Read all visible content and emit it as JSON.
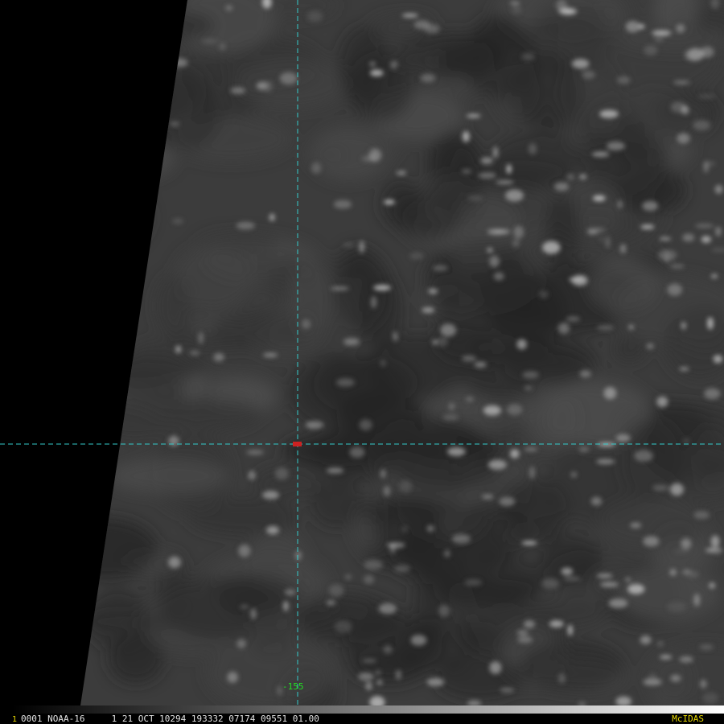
{
  "image": {
    "satellite": "NOAA-16",
    "frame_number": "1",
    "frame_info": "0001 NOAA-16     1 21 OCT 10294 193332 07174 09551 01.00",
    "software_label": "McIDAS",
    "colors": {
      "background": "#000000",
      "gridline": "#33cccc",
      "center_marker": "#cc2222",
      "longitude_label": "#22dd22",
      "frame_number": "#e8d800",
      "frame_info": "#e6e6e6",
      "brand": "#e8d800"
    }
  },
  "grid": {
    "longitude_label": "-155"
  }
}
